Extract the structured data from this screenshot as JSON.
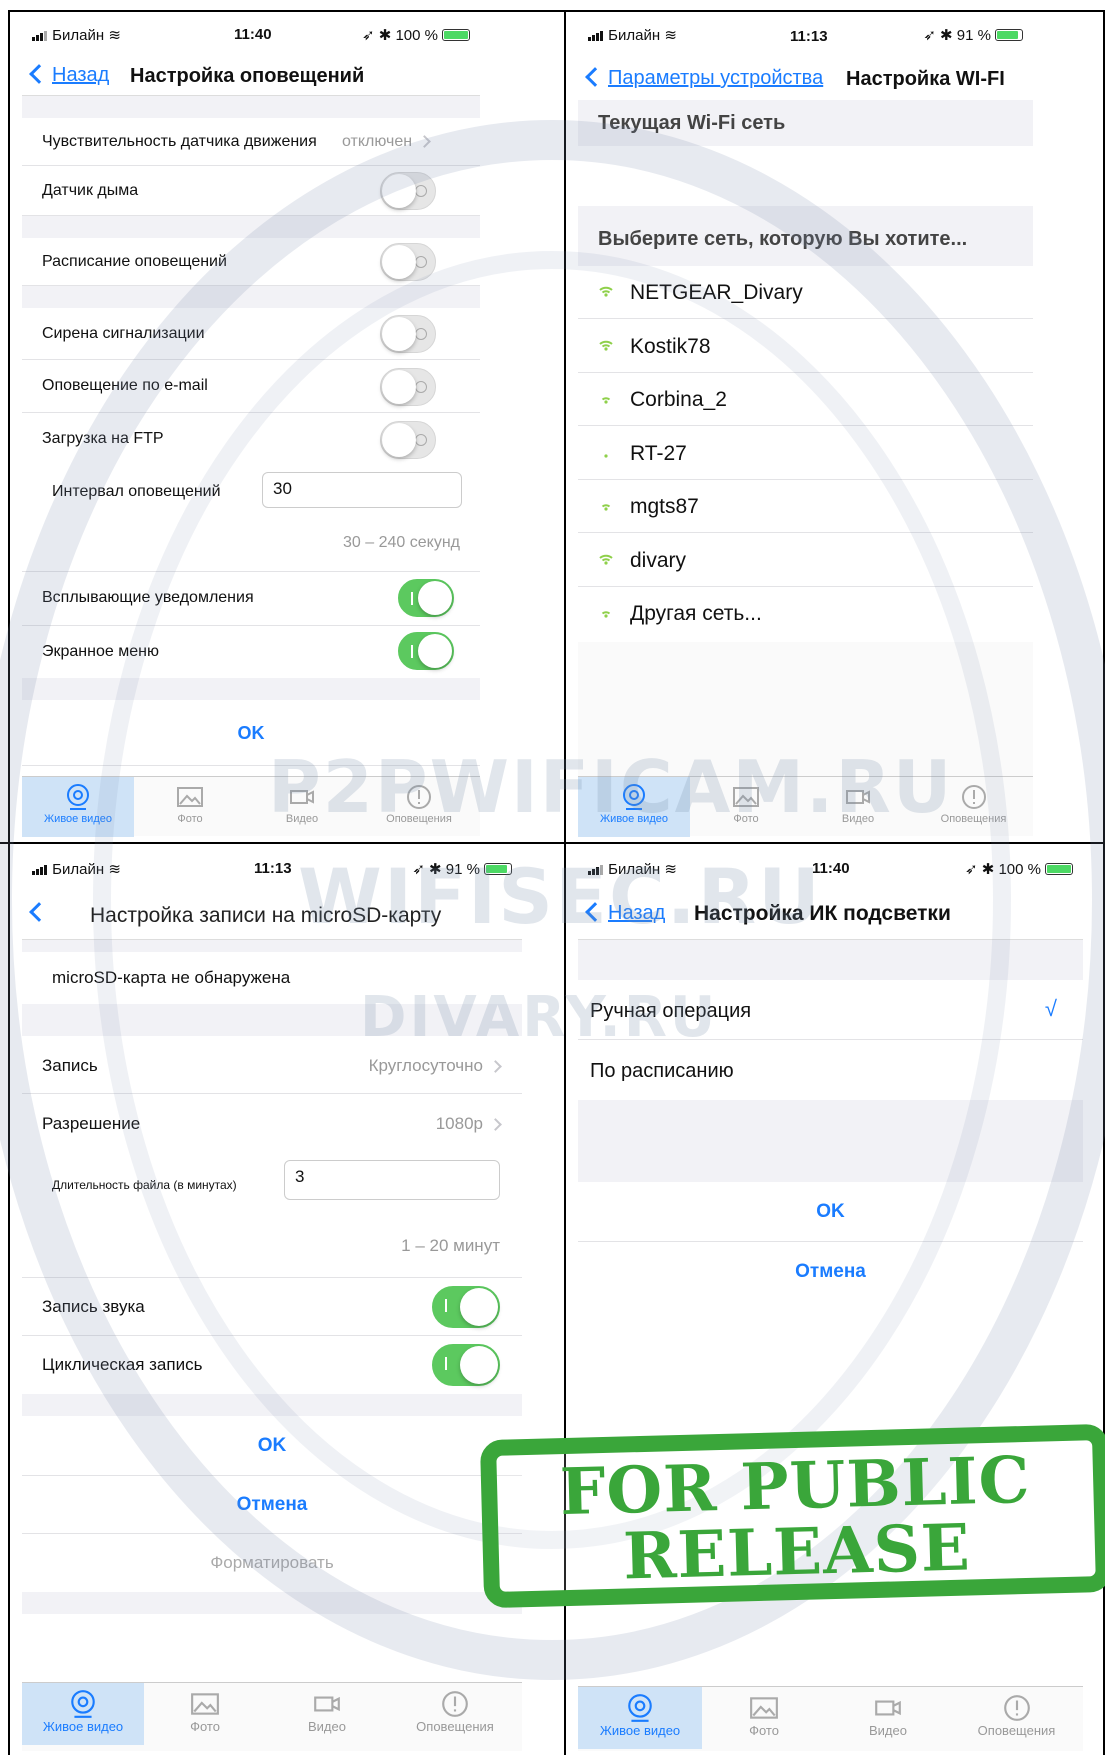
{
  "screens": {
    "alerts": {
      "status": {
        "carrier": "Билайн",
        "time": "11:40",
        "battery": "100 %"
      },
      "nav": {
        "back": "Назад",
        "title": "Настройка оповещений"
      },
      "motion": {
        "label": "Чувствительность датчика движения",
        "value": "отключен"
      },
      "smoke": {
        "label": "Датчик дыма"
      },
      "schedule": {
        "label": "Расписание оповещений"
      },
      "siren": {
        "label": "Сирена сигнализации"
      },
      "email": {
        "label": "Оповещение по e-mail"
      },
      "ftp": {
        "label": "Загрузка на FTP"
      },
      "interval": {
        "label": "Интервал оповещений",
        "value": "30",
        "hint": "30 – 240 секунд"
      },
      "popup": {
        "label": "Всплывающие  уведомления"
      },
      "osd": {
        "label": "Экранное меню"
      },
      "ok": "OK"
    },
    "wifi": {
      "status": {
        "carrier": "Билайн",
        "time": "11:13",
        "battery": "91 %"
      },
      "nav": {
        "back": "Параметры устройства",
        "title": "Настройка WI-FI"
      },
      "current_header": "Текущая Wi-Fi сеть",
      "choose_header": "Выберите сеть, которую Вы хотите...",
      "networks": [
        "NETGEAR_Divary",
        "Kostik78",
        "Corbina_2",
        "RT-27",
        "mgts87",
        "divary",
        "Другая сеть..."
      ]
    },
    "sd": {
      "status": {
        "carrier": "Билайн",
        "time": "11:13",
        "battery": "91 %"
      },
      "nav": {
        "title": "Настройка записи на microSD-карту"
      },
      "no_card": "microSD-карта не обнаружена",
      "record": {
        "label": "Запись",
        "value": "Круглосуточно"
      },
      "resolution": {
        "label": "Разрешение",
        "value": "1080p"
      },
      "duration": {
        "label": "Длительность файла (в минутах)",
        "value": "3",
        "hint": "1 – 20 минут"
      },
      "audio": {
        "label": "Запись звука"
      },
      "loop": {
        "label": "Циклическая запись"
      },
      "ok": "OK",
      "cancel": "Отмена",
      "format": "Форматировать"
    },
    "ir": {
      "status": {
        "carrier": "Билайн",
        "time": "11:40",
        "battery": "100 %"
      },
      "nav": {
        "back": "Назад",
        "title": "Настройка ИК подсветки"
      },
      "manual": "Ручная операция",
      "check": "√",
      "scheduled": "По расписанию",
      "ok": "OK",
      "cancel": "Отмена"
    }
  },
  "tabs": [
    "Живое видео",
    "Фото",
    "Видео",
    "Оповещения"
  ],
  "watermarks": [
    "P2PWIFICAM.RU",
    "WIFISEC.RU",
    "DIVARY.RU"
  ],
  "stamp": {
    "line1": "FOR PUBLIC",
    "line2": "RELEASE"
  },
  "colors": {
    "accent": "#1a7cff",
    "toggle_on": "#5cc95f",
    "stamp": "#3aa63a",
    "active_tab": "#cfe3f7"
  }
}
